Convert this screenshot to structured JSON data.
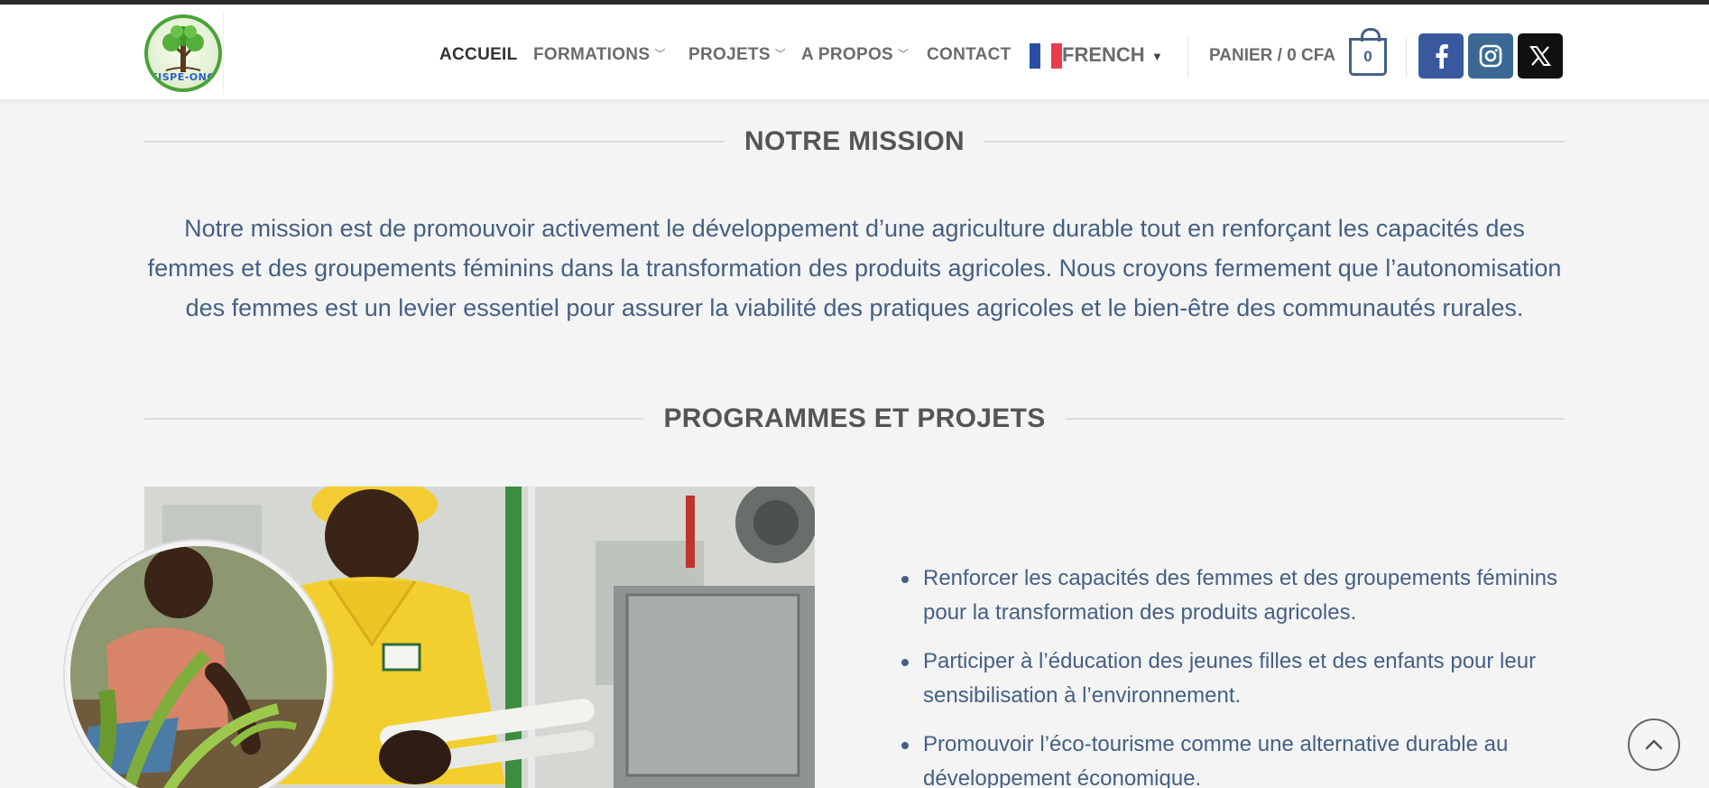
{
  "header": {
    "logo_text": "FJSPE-ONG",
    "nav": [
      {
        "label": "ACCUEIL",
        "dropdown": false
      },
      {
        "label": "FORMATIONS",
        "dropdown": true
      },
      {
        "label": "PROJETS",
        "dropdown": true
      },
      {
        "label": "A PROPOS",
        "dropdown": true
      },
      {
        "label": "CONTACT",
        "dropdown": false
      }
    ],
    "language": {
      "label": "FRENCH",
      "caret": "▼"
    },
    "cart": {
      "label": "PANIER / 0 CFA",
      "count": "0"
    },
    "social": [
      {
        "icon": "facebook-icon",
        "color": "#3a589d"
      },
      {
        "icon": "instagram-icon",
        "color": "#3b6994"
      },
      {
        "icon": "x-twitter-icon",
        "color": "#111111"
      }
    ]
  },
  "mission": {
    "heading": "NOTRE MISSION",
    "text": "Notre mission est de promouvoir activement le développement d’une agriculture durable tout en renforçant les capacités des femmes et des groupements féminins dans la transformation des produits agricoles. Nous croyons fermement que l’autonomisation des femmes est un levier essentiel pour assurer la viabilité des pratiques agricoles et le bien-être des communautés rurales."
  },
  "programmes": {
    "heading": "PROGRAMMES ET PROJETS",
    "items": [
      "Renforcer les capacités des femmes et des groupements féminins pour la transformation des produits agricoles.",
      "Participer à l’éducation des jeunes filles et des enfants pour leur sensibilisation à l’environnement.",
      "Promouvoir l’éco-tourisme comme une alternative durable au développement économique."
    ]
  },
  "colors": {
    "accent": "#446084",
    "heading": "#555555",
    "background": "#f4f4f4"
  },
  "icons": {
    "back_to_top": "chevron-up-icon",
    "nav_chevron": "chevron-down-icon"
  }
}
